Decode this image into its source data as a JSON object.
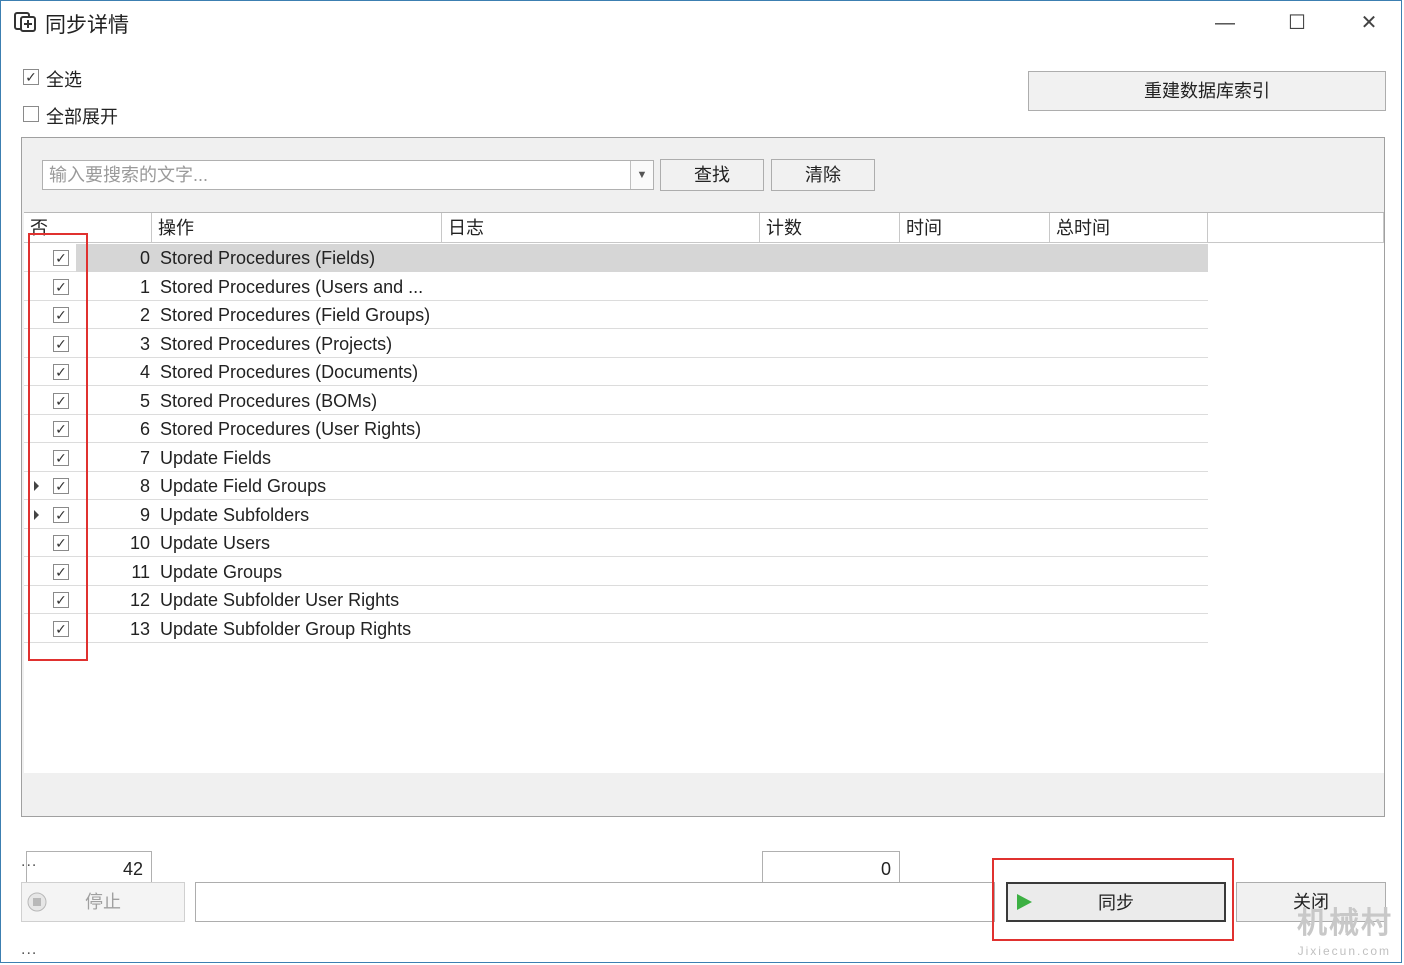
{
  "window": {
    "title": "同步详情",
    "controls": {
      "minimize": "—",
      "maximize": "☐",
      "close": "✕"
    }
  },
  "options": {
    "select_all": {
      "label": "全选",
      "checked": true
    },
    "expand_all": {
      "label": "全部展开",
      "checked": false
    }
  },
  "rebuild_index_button": "重建数据库索引",
  "search": {
    "placeholder": "输入要搜索的文字...",
    "find_button": "查找",
    "clear_button": "清除"
  },
  "table": {
    "columns": [
      "否",
      "操作",
      "日志",
      "计数",
      "时间",
      "总时间"
    ],
    "rows": [
      {
        "num": "0",
        "op": "Stored Procedures (Fields)",
        "checked": true,
        "expandable": false,
        "selected": true
      },
      {
        "num": "1",
        "op": "Stored Procedures (Users and ...",
        "checked": true,
        "expandable": false
      },
      {
        "num": "2",
        "op": "Stored Procedures (Field Groups)",
        "checked": true,
        "expandable": false
      },
      {
        "num": "3",
        "op": "Stored Procedures (Projects)",
        "checked": true,
        "expandable": false
      },
      {
        "num": "4",
        "op": "Stored Procedures (Documents)",
        "checked": true,
        "expandable": false
      },
      {
        "num": "5",
        "op": "Stored Procedures (BOMs)",
        "checked": true,
        "expandable": false
      },
      {
        "num": "6",
        "op": "Stored Procedures (User Rights)",
        "checked": true,
        "expandable": false
      },
      {
        "num": "7",
        "op": "Update Fields",
        "checked": true,
        "expandable": false
      },
      {
        "num": "8",
        "op": "Update Field Groups",
        "checked": true,
        "expandable": true
      },
      {
        "num": "9",
        "op": "Update Subfolders",
        "checked": true,
        "expandable": true
      },
      {
        "num": "10",
        "op": "Update Users",
        "checked": true,
        "expandable": false
      },
      {
        "num": "11",
        "op": "Update Groups",
        "checked": true,
        "expandable": false
      },
      {
        "num": "12",
        "op": "Update Subfolder User Rights",
        "checked": true,
        "expandable": false
      },
      {
        "num": "13",
        "op": "Update Subfolder Group Rights",
        "checked": true,
        "expandable": false
      }
    ],
    "summary": {
      "operation_total": "42",
      "count_total": "0"
    }
  },
  "footer": {
    "ellipsis_top": "...",
    "ellipsis_bottom": "...",
    "stop_button": "停止",
    "sync_button": "同步",
    "close_button": "关闭"
  },
  "watermark": {
    "main": "机械村",
    "sub": "Jixiecun.com"
  },
  "colors": {
    "highlight": "#e0312f",
    "selected_row": "#d6d6d6",
    "sync_icon": "#3cb043"
  }
}
